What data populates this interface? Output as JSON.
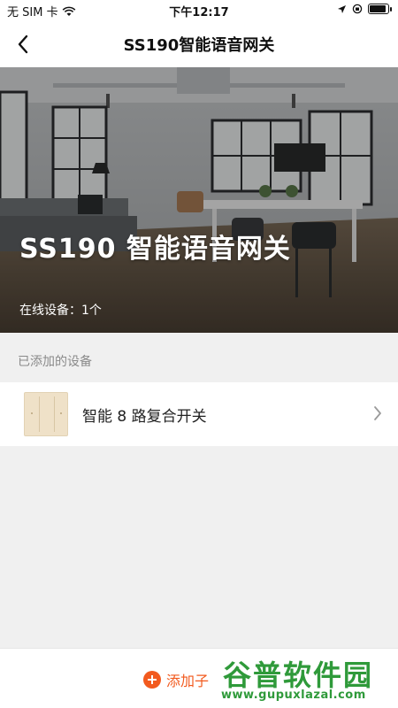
{
  "status_bar": {
    "carrier": "无 SIM 卡",
    "time": "下午12:17",
    "battery_level": 0.9
  },
  "nav": {
    "title": "SS190智能语音网关",
    "back_icon": "chevron-left-icon"
  },
  "hero": {
    "title": "SS190 智能语音网关",
    "online_label": "在线设备：1个"
  },
  "section": {
    "added_devices_label": "已添加的设备"
  },
  "devices": [
    {
      "name": "智能 8 路复合开关",
      "icon": "switch-panel-thumbnail"
    }
  ],
  "bottom": {
    "add_label": "添加子"
  },
  "watermark": {
    "main": "谷普软件园",
    "url": "www.gupuxlazal.com"
  },
  "colors": {
    "accent": "#f25a1e",
    "background": "#f0f0f0",
    "section_text": "#8a8a8a"
  }
}
